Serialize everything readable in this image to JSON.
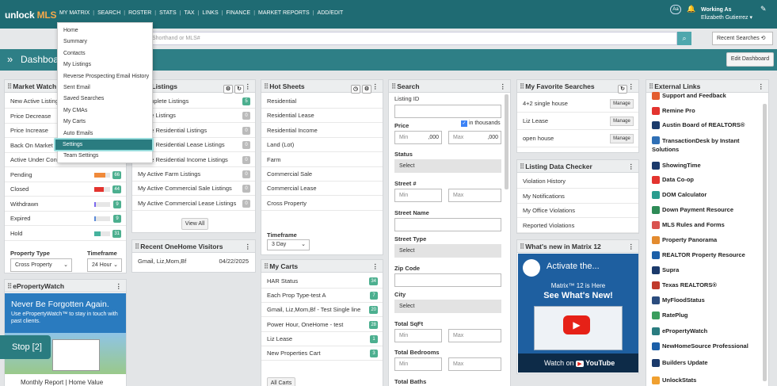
{
  "topnav": {
    "logo_a": "unlock",
    "logo_b": "MLS",
    "menu": [
      "MY MATRIX",
      "SEARCH",
      "ROSTER",
      "STATS",
      "TAX",
      "LINKS",
      "FINANCE",
      "MARKET REPORTS",
      "ADD/EDIT"
    ],
    "font_btn": "Aa",
    "bell_icon": "🔔",
    "working_as_label": "Working As",
    "working_as_name": "Elizabeth Gutierrez",
    "caret": "▾",
    "pen_icon": "✎"
  },
  "search": {
    "placeholder": "Shorthand or MLS#",
    "search_icon": "⌕",
    "recent_label": "Recent Searches",
    "recent_icon": "⟲"
  },
  "dashboard": {
    "chevron": "»",
    "title": "Dashboard",
    "edit_label": "Edit Dashboard"
  },
  "my_matrix_menu": {
    "items": [
      "Home",
      "Summary",
      "Contacts",
      "My Listings",
      "Reverse Prospecting Email History",
      "Sent Email",
      "Saved Searches",
      "My CMAs",
      "My Carts",
      "Auto Emails",
      "Settings",
      "Team Settings"
    ],
    "selected": "Settings"
  },
  "market_watch": {
    "title": "Market Watch",
    "rows": [
      {
        "label": "New Active Listings"
      },
      {
        "label": "Price Decrease"
      },
      {
        "label": "Price Increase"
      },
      {
        "label": "Back On Market"
      },
      {
        "label": "Active Under Contract"
      },
      {
        "label": "Pending",
        "count": "66",
        "bar_color": "#f08a3a",
        "bar_fill": 0.7
      },
      {
        "label": "Closed",
        "count": "44",
        "bar_color": "#e3342f",
        "bar_fill": 0.6
      },
      {
        "label": "Withdrawn",
        "count": "9",
        "bar_color": "#7b68ee",
        "bar_fill": 0.1
      },
      {
        "label": "Expired",
        "count": "9",
        "bar_color": "#5b8bd8",
        "bar_fill": 0.1
      },
      {
        "label": "Hold",
        "count": "31",
        "bar_color": "#45b29d",
        "bar_fill": 0.4
      }
    ],
    "property_type_label": "Property Type",
    "property_type_value": "Cross Property",
    "timeframe_label": "Timeframe",
    "timeframe_value": "24 Hour"
  },
  "my_listings": {
    "title": "My Listings",
    "rows": [
      {
        "label": "Incomplete Listings",
        "count": "5"
      },
      {
        "label": "Active Listings",
        "count": "0"
      },
      {
        "label": "Active Residential Listings",
        "count": "0"
      },
      {
        "label": "Active Residential Lease Listings",
        "count": "0"
      },
      {
        "label": "Active Residential Income Listings",
        "count": "0"
      },
      {
        "label": "My Active Farm Listings",
        "count": "0"
      },
      {
        "label": "My Active Commercial Sale Listings",
        "count": "0"
      },
      {
        "label": "My Active Commercial Lease Listings",
        "count": "0"
      }
    ],
    "view_all": "View All"
  },
  "onehome": {
    "title": "Recent OneHome Visitors",
    "visitor": "Gmail, Liz,Mom,Bf",
    "date": "04/22/2025"
  },
  "epropertywatch": {
    "title": "ePropertyWatch",
    "headline": "Never Be Forgotten Again.",
    "body": "Use ePropertyWatch™ to stay in touch with past clients.",
    "footer": "Monthly Report | Home Value"
  },
  "hot_sheets": {
    "title": "Hot Sheets",
    "rows": [
      "Residential",
      "Residential Lease",
      "Residential Income",
      "Land (Lot)",
      "Farm",
      "Commercial Sale",
      "Commercial Lease",
      "Cross Property"
    ],
    "timeframe_label": "Timeframe",
    "timeframe_value": "3 Day"
  },
  "my_carts": {
    "title": "My Carts",
    "rows": [
      {
        "label": "HAR Status",
        "count": "34"
      },
      {
        "label": "Each Prop Type-test A",
        "count": "7"
      },
      {
        "label": "Gmail, Liz,Mom,Bf - Test Single line",
        "count": "20"
      },
      {
        "label": "Power Hour, OneHome - test",
        "count": "28"
      },
      {
        "label": "Liz Lease",
        "count": "1"
      },
      {
        "label": "New Properties Cart",
        "count": "3"
      }
    ],
    "all_carts": "All Carts"
  },
  "search_panel": {
    "title": "Search",
    "listing_id": "Listing ID",
    "price": "Price",
    "in_thousands": "in thousands",
    "min": "Min",
    "max": "Max",
    "suffix": ",000",
    "status": "Status",
    "select": "Select",
    "street_num": "Street #",
    "street_name": "Street Name",
    "street_type": "Street Type",
    "zip": "Zip Code",
    "city": "City",
    "total_sqft": "Total SqFt",
    "total_bedrooms": "Total Bedrooms",
    "total_baths": "Total Baths"
  },
  "favorites": {
    "title": "My Favorite Searches",
    "rows": [
      "4+2 single house",
      "Liz Lease",
      "open house"
    ],
    "manage": "Manage"
  },
  "data_checker": {
    "title": "Listing Data Checker",
    "rows": [
      "Violation History",
      "My Notifications",
      "My Office Violations",
      "Reported Violations"
    ]
  },
  "whats_new": {
    "title": "What's new in Matrix 12",
    "video_title": "Activate the...",
    "line1": "Matrix™ 12 is Here",
    "line2": "See What's New!",
    "watch_on": "Watch on",
    "youtube": "YouTube"
  },
  "external_links": {
    "title": "External Links",
    "items": [
      {
        "label": "Support and Feedback",
        "color": "#e35d2f"
      },
      {
        "label": "Remine Pro",
        "color": "#e3342f"
      },
      {
        "label": "Austin Board of REALTORS®",
        "color": "#1b3a6b"
      },
      {
        "label": "TransactionDesk by Instant Solutions",
        "color": "#2f6fb5"
      },
      {
        "label": "ShowingTime",
        "color": "#1b3a6b"
      },
      {
        "label": "Data Co-op",
        "color": "#e3342f"
      },
      {
        "label": "DOM Calculator",
        "color": "#2a9d8f"
      },
      {
        "label": "Down Payment Resource",
        "color": "#2e8b57"
      },
      {
        "label": "MLS Rules and Forms",
        "color": "#d9534f"
      },
      {
        "label": "Property Panorama",
        "color": "#e38b2f"
      },
      {
        "label": "REALTOR Property Resource",
        "color": "#1b5fa8"
      },
      {
        "label": "Supra",
        "color": "#1b3a6b"
      },
      {
        "label": "Texas REALTORS®",
        "color": "#c0392b"
      },
      {
        "label": "MyFloodStatus",
        "color": "#2b4c7e"
      },
      {
        "label": "RatePlug",
        "color": "#3a9d5d"
      },
      {
        "label": "ePropertyWatch",
        "color": "#2a7c80"
      },
      {
        "label": "NewHomeSource Professional",
        "color": "#1b5fa8"
      },
      {
        "label": "Builders Update",
        "color": "#1b3a6b"
      },
      {
        "label": "UnlockStats",
        "color": "#f0a030"
      }
    ]
  },
  "stop_button": "Stop [2]"
}
